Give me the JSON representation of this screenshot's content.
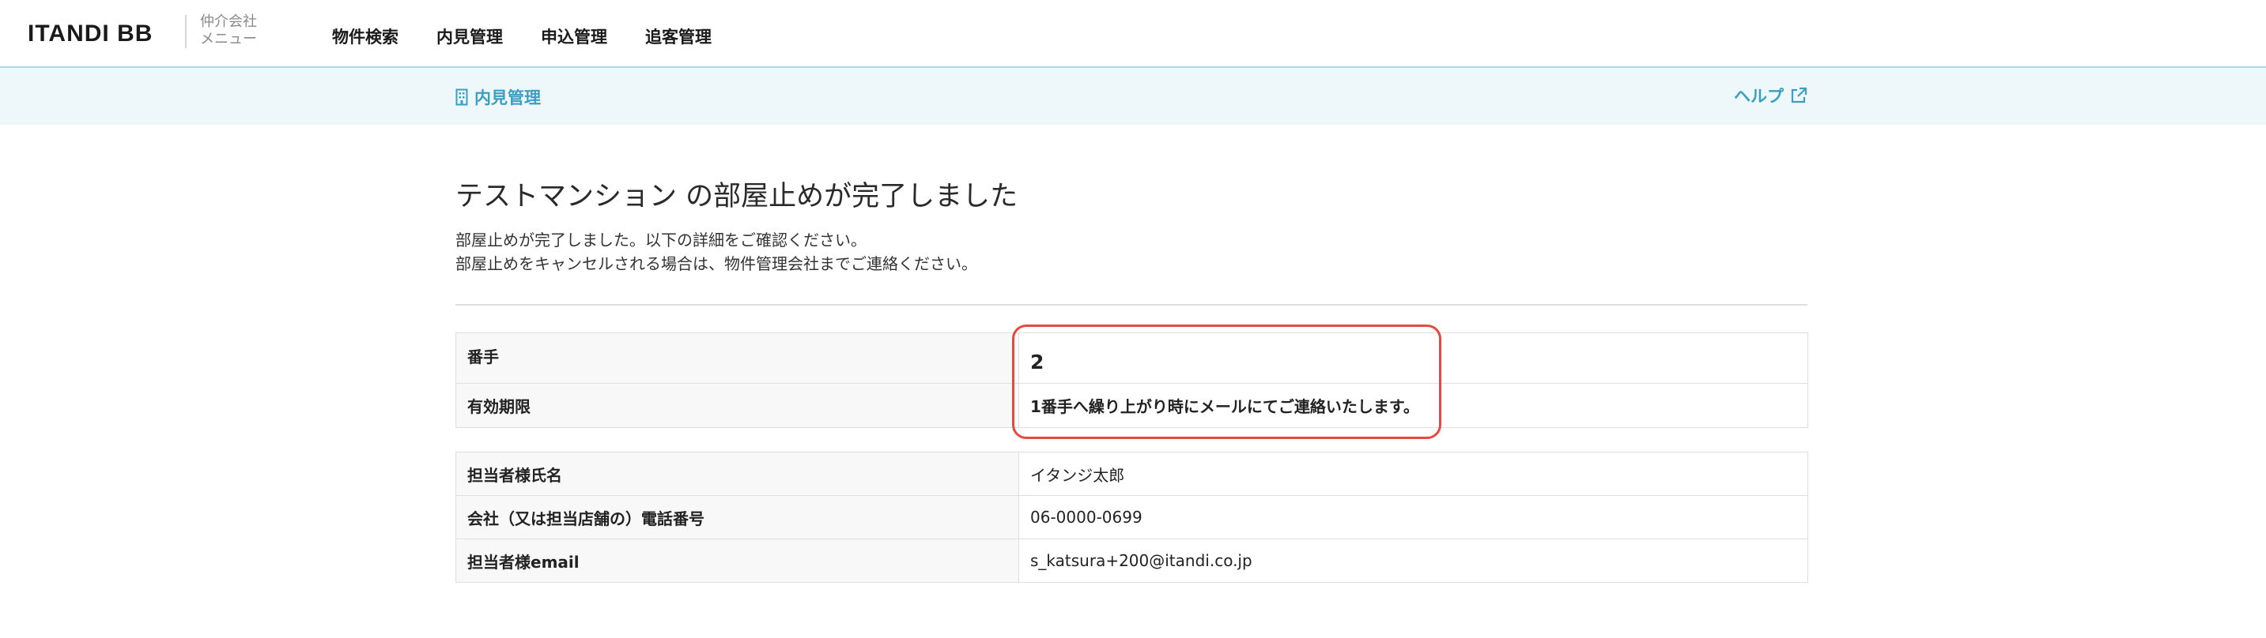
{
  "header": {
    "logo": "ITANDI BB",
    "menu_tag_line1": "仲介会社",
    "menu_tag_line2": "メニュー",
    "nav": [
      "物件検索",
      "内見管理",
      "申込管理",
      "追客管理"
    ]
  },
  "subheader": {
    "breadcrumb": "内見管理",
    "help": "ヘルプ"
  },
  "main": {
    "title": "テストマンション の部屋止めが完了しました",
    "desc_line1": "部屋止めが完了しました。以下の詳細をご確認ください。",
    "desc_line2": "部屋止めをキャンセルされる場合は、物件管理会社までご連絡ください。",
    "result_rows": [
      {
        "label": "番手",
        "value": "2"
      },
      {
        "label": "有効期限",
        "value": "1番手へ繰り上がり時にメールにてご連絡いたします。"
      }
    ],
    "contact_rows": [
      {
        "label": "担当者様氏名",
        "value": "イタンジ太郎"
      },
      {
        "label": "会社（又は担当店舗の）電話番号",
        "value": "06-0000-0699"
      },
      {
        "label": "担当者様email",
        "value": "s_katsura+200@itandi.co.jp"
      }
    ]
  },
  "colors": {
    "accent": "#3b9fc2",
    "highlight": "#e5493f",
    "subbar_bg": "#eef7fa"
  },
  "icons": {
    "breadcrumb": "building-icon",
    "help": "external-link-icon"
  }
}
